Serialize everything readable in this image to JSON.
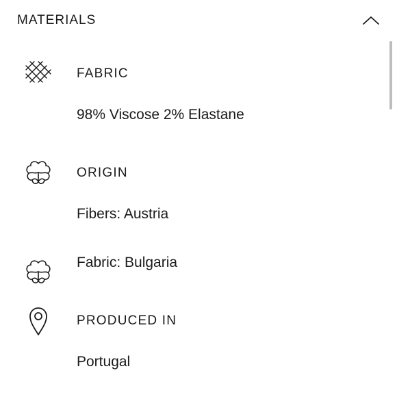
{
  "section": {
    "title": "MATERIALS",
    "toggle_icon": "chevron-up-icon"
  },
  "fabric": {
    "icon": "weave-icon",
    "label": "FABRIC",
    "value": "98% Viscose 2% Elastane"
  },
  "origin": {
    "icon": "cotton-icon",
    "label": "ORIGIN",
    "fibers": "Fibers: Austria",
    "fabric_icon": "cotton-icon",
    "fabric": "Fabric: Bulgaria"
  },
  "produced": {
    "icon": "location-pin-icon",
    "label": "PRODUCED IN",
    "value": "Portugal"
  }
}
